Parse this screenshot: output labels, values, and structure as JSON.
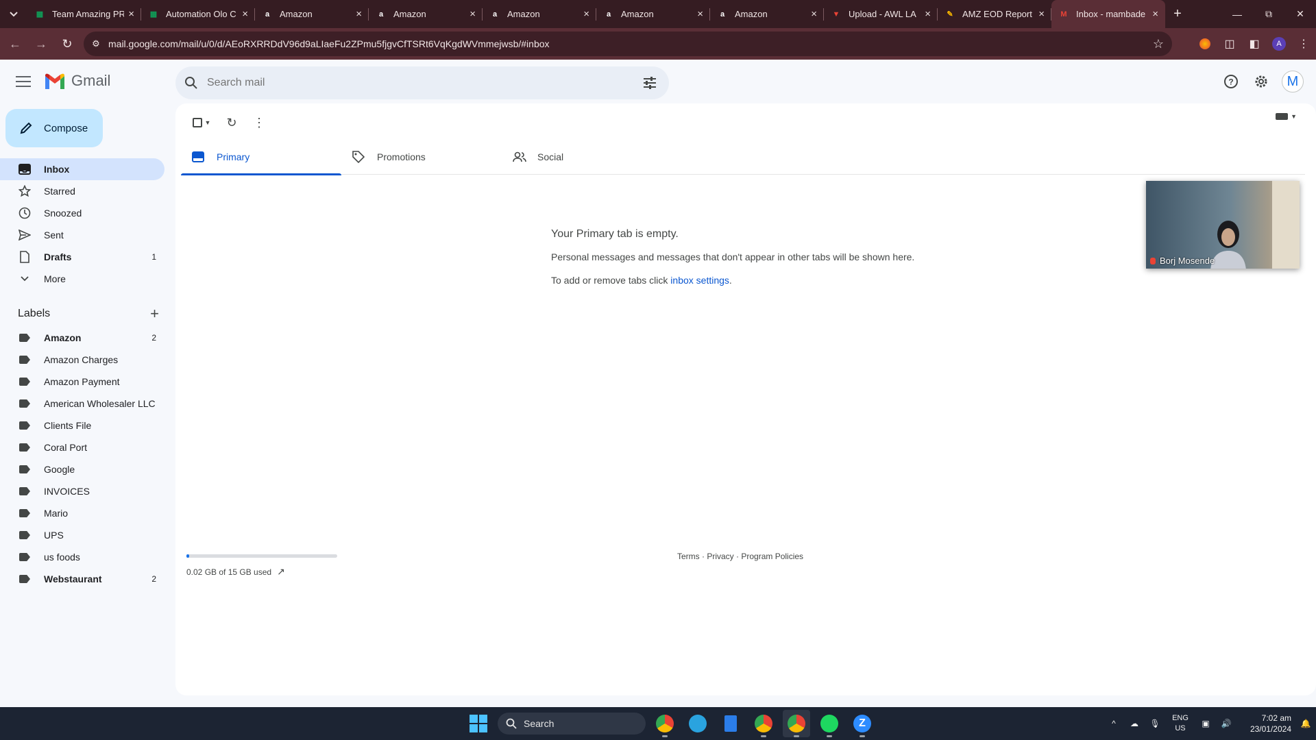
{
  "browser": {
    "tabs": [
      {
        "title": "Team Amazing PR",
        "icon": "sheets-icon",
        "active": false
      },
      {
        "title": "Automation Olo C",
        "icon": "sheets-icon",
        "active": false
      },
      {
        "title": "Amazon",
        "icon": "amazon-icon",
        "active": false
      },
      {
        "title": "Amazon",
        "icon": "amazon-icon",
        "active": false
      },
      {
        "title": "Amazon",
        "icon": "amazon-icon",
        "active": false
      },
      {
        "title": "Amazon",
        "icon": "amazon-icon",
        "active": false
      },
      {
        "title": "Amazon",
        "icon": "amazon-icon",
        "active": false
      },
      {
        "title": "Upload - AWL LA",
        "icon": "upload-icon",
        "active": false
      },
      {
        "title": "AMZ EOD Report",
        "icon": "report-icon",
        "active": false
      },
      {
        "title": "Inbox - mambade",
        "icon": "gmail-icon",
        "active": true
      }
    ],
    "url": "mail.google.com/mail/u/0/d/AEoRXRRDdV96d9aLIaeFu2ZPmu5fjgvCfTSRt6VqKgdWVmmejwsb/#inbox",
    "profile_initial": "A"
  },
  "gmail": {
    "product_name": "Gmail",
    "search_placeholder": "Search mail",
    "avatar_initial": "M",
    "compose_label": "Compose",
    "nav": [
      {
        "label": "Inbox",
        "count": "",
        "icon": "inbox-icon"
      },
      {
        "label": "Starred",
        "count": "",
        "icon": "star-icon"
      },
      {
        "label": "Snoozed",
        "count": "",
        "icon": "clock-icon"
      },
      {
        "label": "Sent",
        "count": "",
        "icon": "send-icon"
      },
      {
        "label": "Drafts",
        "count": "1",
        "icon": "draft-icon"
      },
      {
        "label": "More",
        "count": "",
        "icon": "chevron-down-icon"
      }
    ],
    "labels_heading": "Labels",
    "labels": [
      {
        "label": "Amazon",
        "count": "2",
        "bold": true
      },
      {
        "label": "Amazon Charges",
        "count": "",
        "bold": false
      },
      {
        "label": "Amazon Payment",
        "count": "",
        "bold": false
      },
      {
        "label": "American Wholesaler LLC",
        "count": "",
        "bold": false
      },
      {
        "label": "Clients File",
        "count": "",
        "bold": false
      },
      {
        "label": "Coral Port",
        "count": "",
        "bold": false
      },
      {
        "label": "Google",
        "count": "",
        "bold": false
      },
      {
        "label": "INVOICES",
        "count": "",
        "bold": false
      },
      {
        "label": "Mario",
        "count": "",
        "bold": false
      },
      {
        "label": "UPS",
        "count": "",
        "bold": false
      },
      {
        "label": "us foods",
        "count": "",
        "bold": false
      },
      {
        "label": "Webstaurant",
        "count": "2",
        "bold": true
      }
    ],
    "tabs": [
      {
        "label": "Primary",
        "icon": "inbox-tab-icon"
      },
      {
        "label": "Promotions",
        "icon": "tag-icon"
      },
      {
        "label": "Social",
        "icon": "people-icon"
      }
    ],
    "empty": {
      "heading": "Your Primary tab is empty.",
      "line1": "Personal messages and messages that don't appear in other tabs will be shown here.",
      "line2_prefix": "To add or remove tabs click ",
      "line2_link": "inbox settings",
      "line2_suffix": "."
    },
    "storage": {
      "text": "0.02 GB of 15 GB used",
      "fraction": 0.0013
    },
    "footer": {
      "terms": "Terms",
      "privacy": "Privacy",
      "policies": "Program Policies",
      "sep": " · "
    },
    "video_call": {
      "participant": "Borj Mosende"
    }
  },
  "taskbar": {
    "search_label": "Search",
    "lang1": "ENG",
    "lang2": "US",
    "time": "7:02 am",
    "date": "23/01/2024"
  },
  "colors": {
    "accent": "#0b57d0",
    "compose_bg": "#c2e7ff",
    "active_nav": "#d3e3fd",
    "browser_frame": "#5a2e36"
  }
}
